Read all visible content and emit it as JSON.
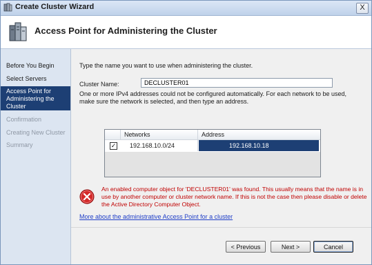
{
  "window": {
    "title": "Create Cluster Wizard",
    "close_glyph": "X"
  },
  "header": {
    "title": "Access Point for Administering the Cluster"
  },
  "nav": {
    "items": [
      {
        "label": "Before You Begin",
        "state": "normal"
      },
      {
        "label": "Select Servers",
        "state": "normal"
      },
      {
        "label": "Access Point for Administering the Cluster",
        "state": "active"
      },
      {
        "label": "Confirmation",
        "state": "disabled"
      },
      {
        "label": "Creating New Cluster",
        "state": "disabled"
      },
      {
        "label": "Summary",
        "state": "disabled"
      }
    ]
  },
  "content": {
    "instruction": "Type the name you want to use when administering the cluster.",
    "cluster_name_label": "Cluster Name:",
    "cluster_name_value": "DECLUSTER01",
    "ipv4_note": "One or more IPv4 addresses could not be configured automatically.  For each network to be used, make sure the network is selected, and then type an address.",
    "grid": {
      "columns": [
        "Networks",
        "Address"
      ],
      "rows": [
        {
          "checked": true,
          "network": "192.168.10.0/24",
          "address": "192.168.10.18"
        }
      ],
      "check_glyph": "✓"
    },
    "error_message": "An enabled computer object for 'DECLUSTER01' was found.  This usually means that the name is in use by another computer or cluster network name.  If this is not the case then please disable or delete the Active Directory Computer Object.",
    "link_text": "More about the administrative Access Point for a cluster"
  },
  "buttons": {
    "previous": "< Previous",
    "next": "Next >",
    "cancel": "Cancel"
  },
  "colors": {
    "nav_active": "#1d3f74",
    "error_text": "#c00000",
    "link": "#1f3ec7"
  },
  "icons": {
    "app": "cluster-icon",
    "header": "server-cluster-icon",
    "error": "error-icon"
  }
}
